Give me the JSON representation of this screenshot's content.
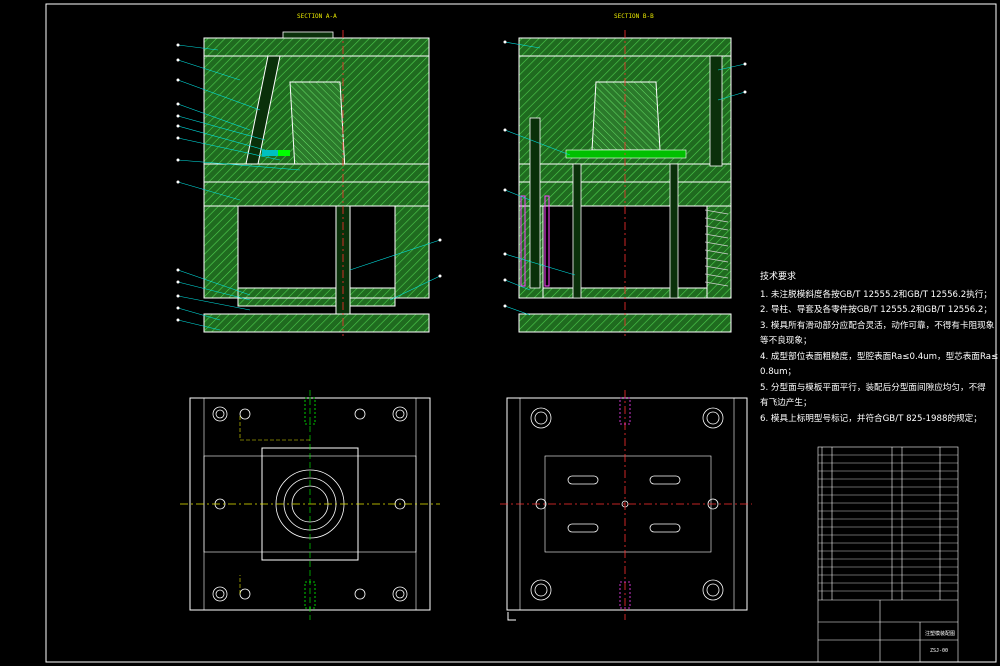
{
  "drawing": {
    "section_a_title": "SECTION A-A",
    "section_b_title": "SECTION B-B",
    "tech_requirements": {
      "title": "技术要求",
      "items": [
        "1. 未注脱模斜度各按GB/T 12555.2和GB/T 12556.2执行；",
        "2. 导柱、导套及各零件按GB/T 12555.2和GB/T 12556.2；",
        "3. 模具所有滑动部分应配合灵活，动作可靠，不得有卡阻现象",
        "   等不良现象；",
        "4. 成型部位表面粗糙度，型腔表面Ra≤0.4um，型芯表面Ra≤",
        "   0.8um；",
        "5. 分型面与模板平面平行，装配后分型面间隙应均匀，不得",
        "   有飞边产生；",
        "6. 模具上标明型号标记，并符合GB/T 825-1988的规定；"
      ]
    },
    "title_block": {
      "drawing_name": "注塑模装配图",
      "drawing_no": "ZSJ-00"
    },
    "colors": {
      "background": "#000000",
      "outline": "#ffffff",
      "hatch_fill": "#1f6b1f",
      "hatch_line": "#4fd04f",
      "centerline": "#ff3030",
      "leader": "#00e0e0",
      "section_label": "#e8e800",
      "spring": "#d0d0d0",
      "magenta": "#ff40ff"
    }
  }
}
